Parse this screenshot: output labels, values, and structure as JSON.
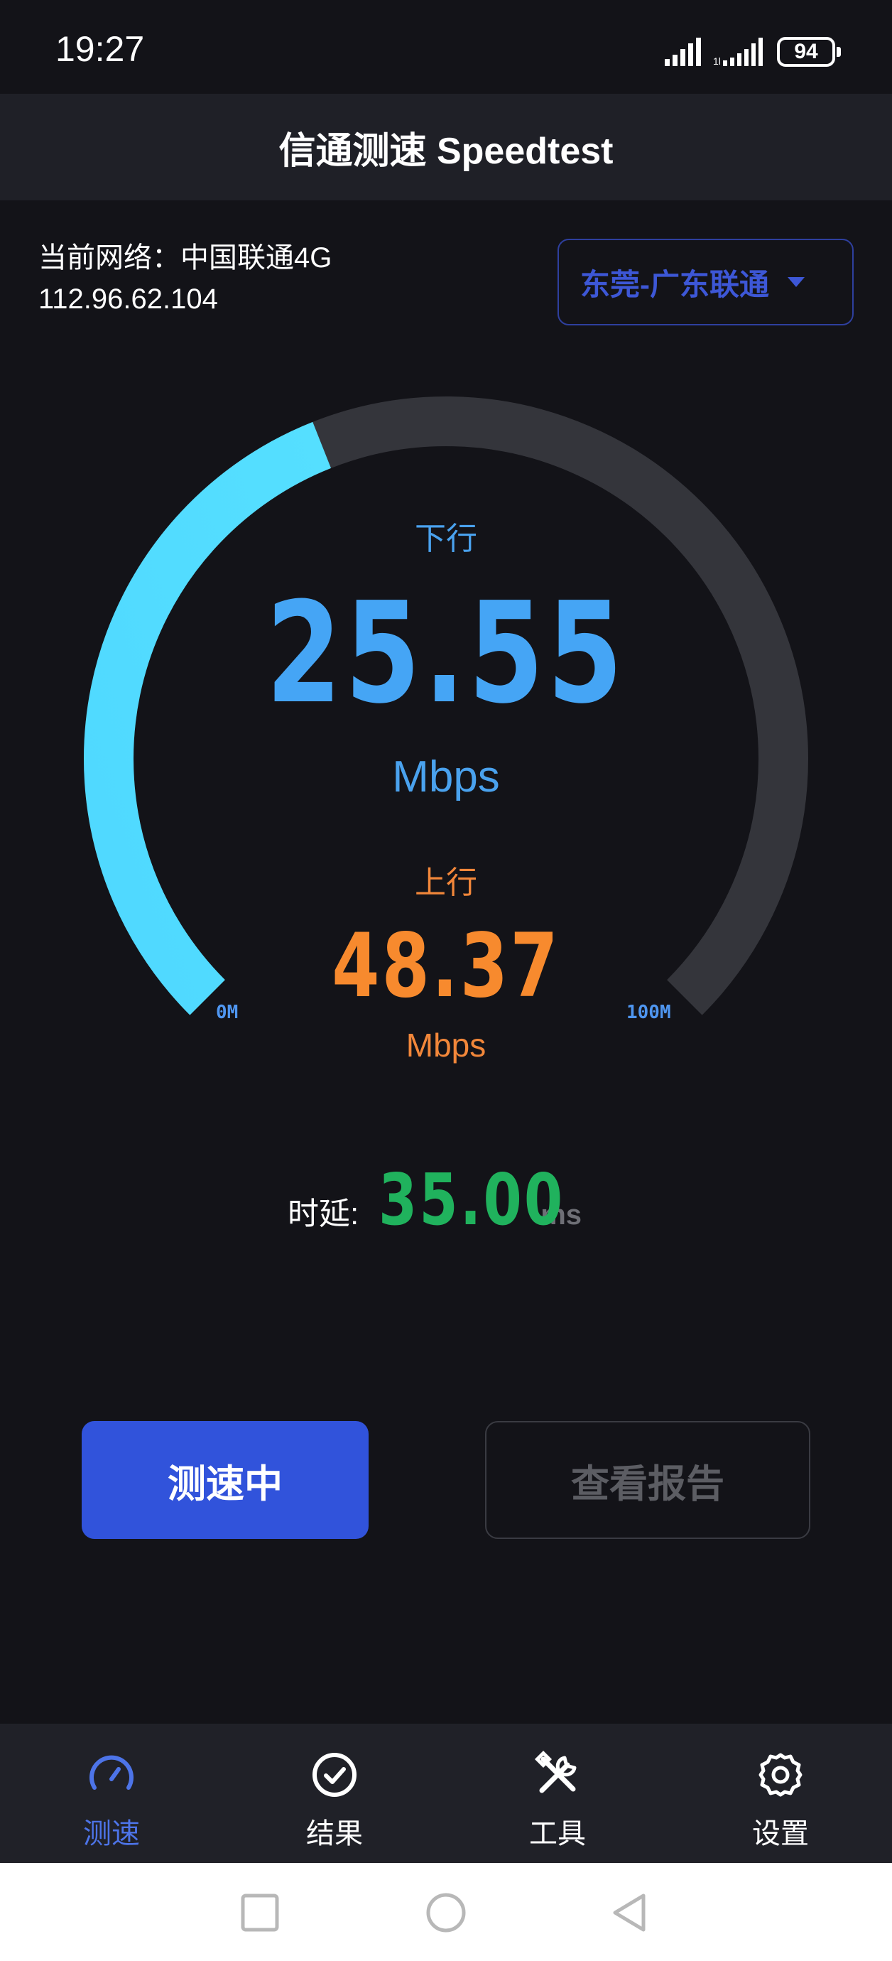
{
  "status_bar": {
    "time": "19:27",
    "battery": "94",
    "icons": [
      "signal-icon",
      "signal-icon-2",
      "battery-icon"
    ]
  },
  "header": {
    "title": "信通测速 Speedtest"
  },
  "network": {
    "current": "当前网络：中国联通4G",
    "ip": "112.96.62.104"
  },
  "server": {
    "selected": "东莞-广东联通",
    "icon": "caret-down-icon"
  },
  "gauge": {
    "min_label": "0M",
    "max_label": "100M",
    "progress_fraction": 0.42,
    "colors": {
      "track": "#34353b",
      "fill_start": "#4fd8ff",
      "fill_end": "#3ec2ff"
    }
  },
  "download": {
    "label": "下行",
    "value": "25.55",
    "unit": "Mbps",
    "color": "#45a5f5"
  },
  "upload": {
    "label": "上行",
    "value": "48.37",
    "unit": "Mbps",
    "color": "#f78a2e"
  },
  "latency": {
    "label": "时延:",
    "value": "35.00",
    "unit": "ms",
    "color": "#20b25d"
  },
  "buttons": {
    "testing": "测速中",
    "report": "查看报告"
  },
  "bottom_nav": {
    "items": [
      {
        "label": "测速",
        "icon": "speedometer-icon",
        "active": true
      },
      {
        "label": "结果",
        "icon": "check-circle-icon",
        "active": false
      },
      {
        "label": "工具",
        "icon": "tools-icon",
        "active": false
      },
      {
        "label": "设置",
        "icon": "gear-icon",
        "active": false
      }
    ]
  },
  "system_nav": {
    "icons": [
      "recent-apps-icon",
      "home-icon",
      "back-icon"
    ]
  },
  "colors": {
    "accent": "#3153db",
    "background": "#131318"
  }
}
